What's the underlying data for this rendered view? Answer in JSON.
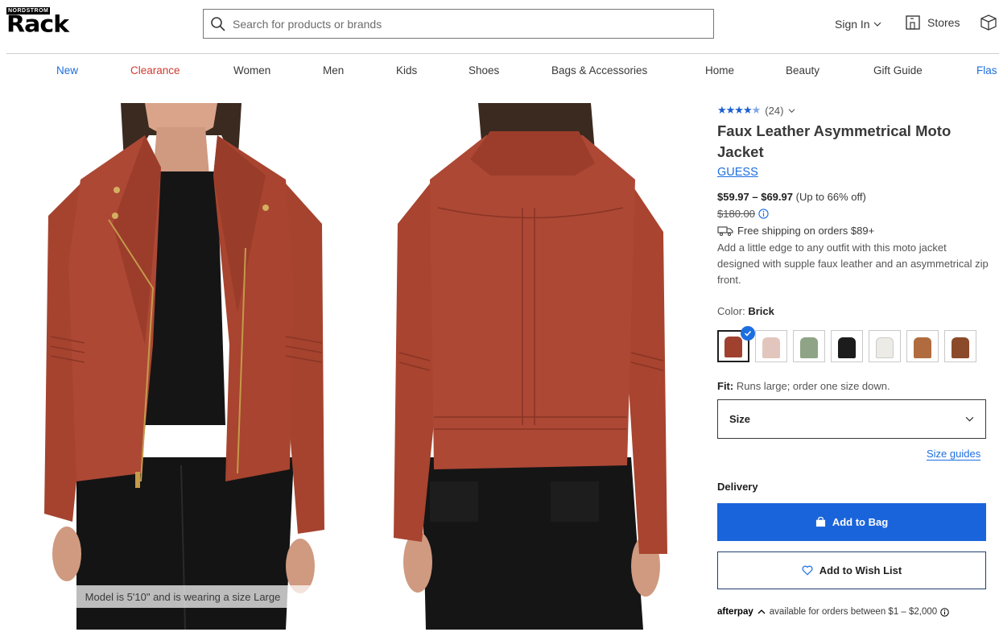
{
  "header": {
    "logo_small": "NORDSTROM",
    "logo_big": "Rack",
    "search_placeholder": "Search for products or brands",
    "signin_label": "Sign In",
    "stores_label": "Stores"
  },
  "nav": {
    "items": [
      {
        "label": "New",
        "color": "#1d6ee0"
      },
      {
        "label": "Clearance",
        "color": "#d03a2f"
      },
      {
        "label": "Women",
        "color": "#393939"
      },
      {
        "label": "Men",
        "color": "#393939"
      },
      {
        "label": "Kids",
        "color": "#393939"
      },
      {
        "label": "Shoes",
        "color": "#393939"
      },
      {
        "label": "Bags & Accessories",
        "color": "#393939"
      },
      {
        "label": "Home",
        "color": "#393939"
      },
      {
        "label": "Beauty",
        "color": "#393939"
      },
      {
        "label": "Gift Guide",
        "color": "#393939"
      },
      {
        "label": "Flas",
        "color": "#1d6ee0"
      }
    ]
  },
  "gallery": {
    "caption": "Model is 5'10\" and is wearing a size Large"
  },
  "product": {
    "rating_value": 4.5,
    "rating_count": "(24)",
    "title": "Faux Leather Asymmetrical Moto Jacket",
    "brand": "GUESS",
    "price_range": "$59.97 – $69.97",
    "discount": "(Up to 66% off)",
    "original_price": "$180.00",
    "shipping": "Free shipping on orders $89+",
    "description": "Add a little edge to any outfit with this moto jacket designed with supple faux leather and an asymmetrical zip front.",
    "color_label": "Color:",
    "color_value": "Brick",
    "swatches": [
      {
        "name": "Brick",
        "color": "#a0412f",
        "selected": true
      },
      {
        "name": "Blush",
        "color": "#e2c6bd",
        "selected": false
      },
      {
        "name": "Sage",
        "color": "#8fa386",
        "selected": false
      },
      {
        "name": "Black",
        "color": "#1c1c1c",
        "selected": false
      },
      {
        "name": "White",
        "color": "#ecebe6",
        "selected": false
      },
      {
        "name": "Cognac",
        "color": "#b06c3e",
        "selected": false
      },
      {
        "name": "Brown",
        "color": "#8b4a2a",
        "selected": false
      }
    ],
    "fit_label": "Fit:",
    "fit_text": "Runs large; order one size down.",
    "size_label": "Size",
    "size_guides": "Size guides",
    "delivery_label": "Delivery",
    "add_to_bag": "Add to Bag",
    "add_to_wishlist": "Add to Wish List",
    "afterpay_brand": "afterpay",
    "afterpay_text": "available for orders between $1 – $2,000"
  },
  "colors": {
    "accent": "#1a64db",
    "link": "#1d6ee0",
    "star": "#1a5fd0",
    "clearance": "#d03a2f"
  }
}
